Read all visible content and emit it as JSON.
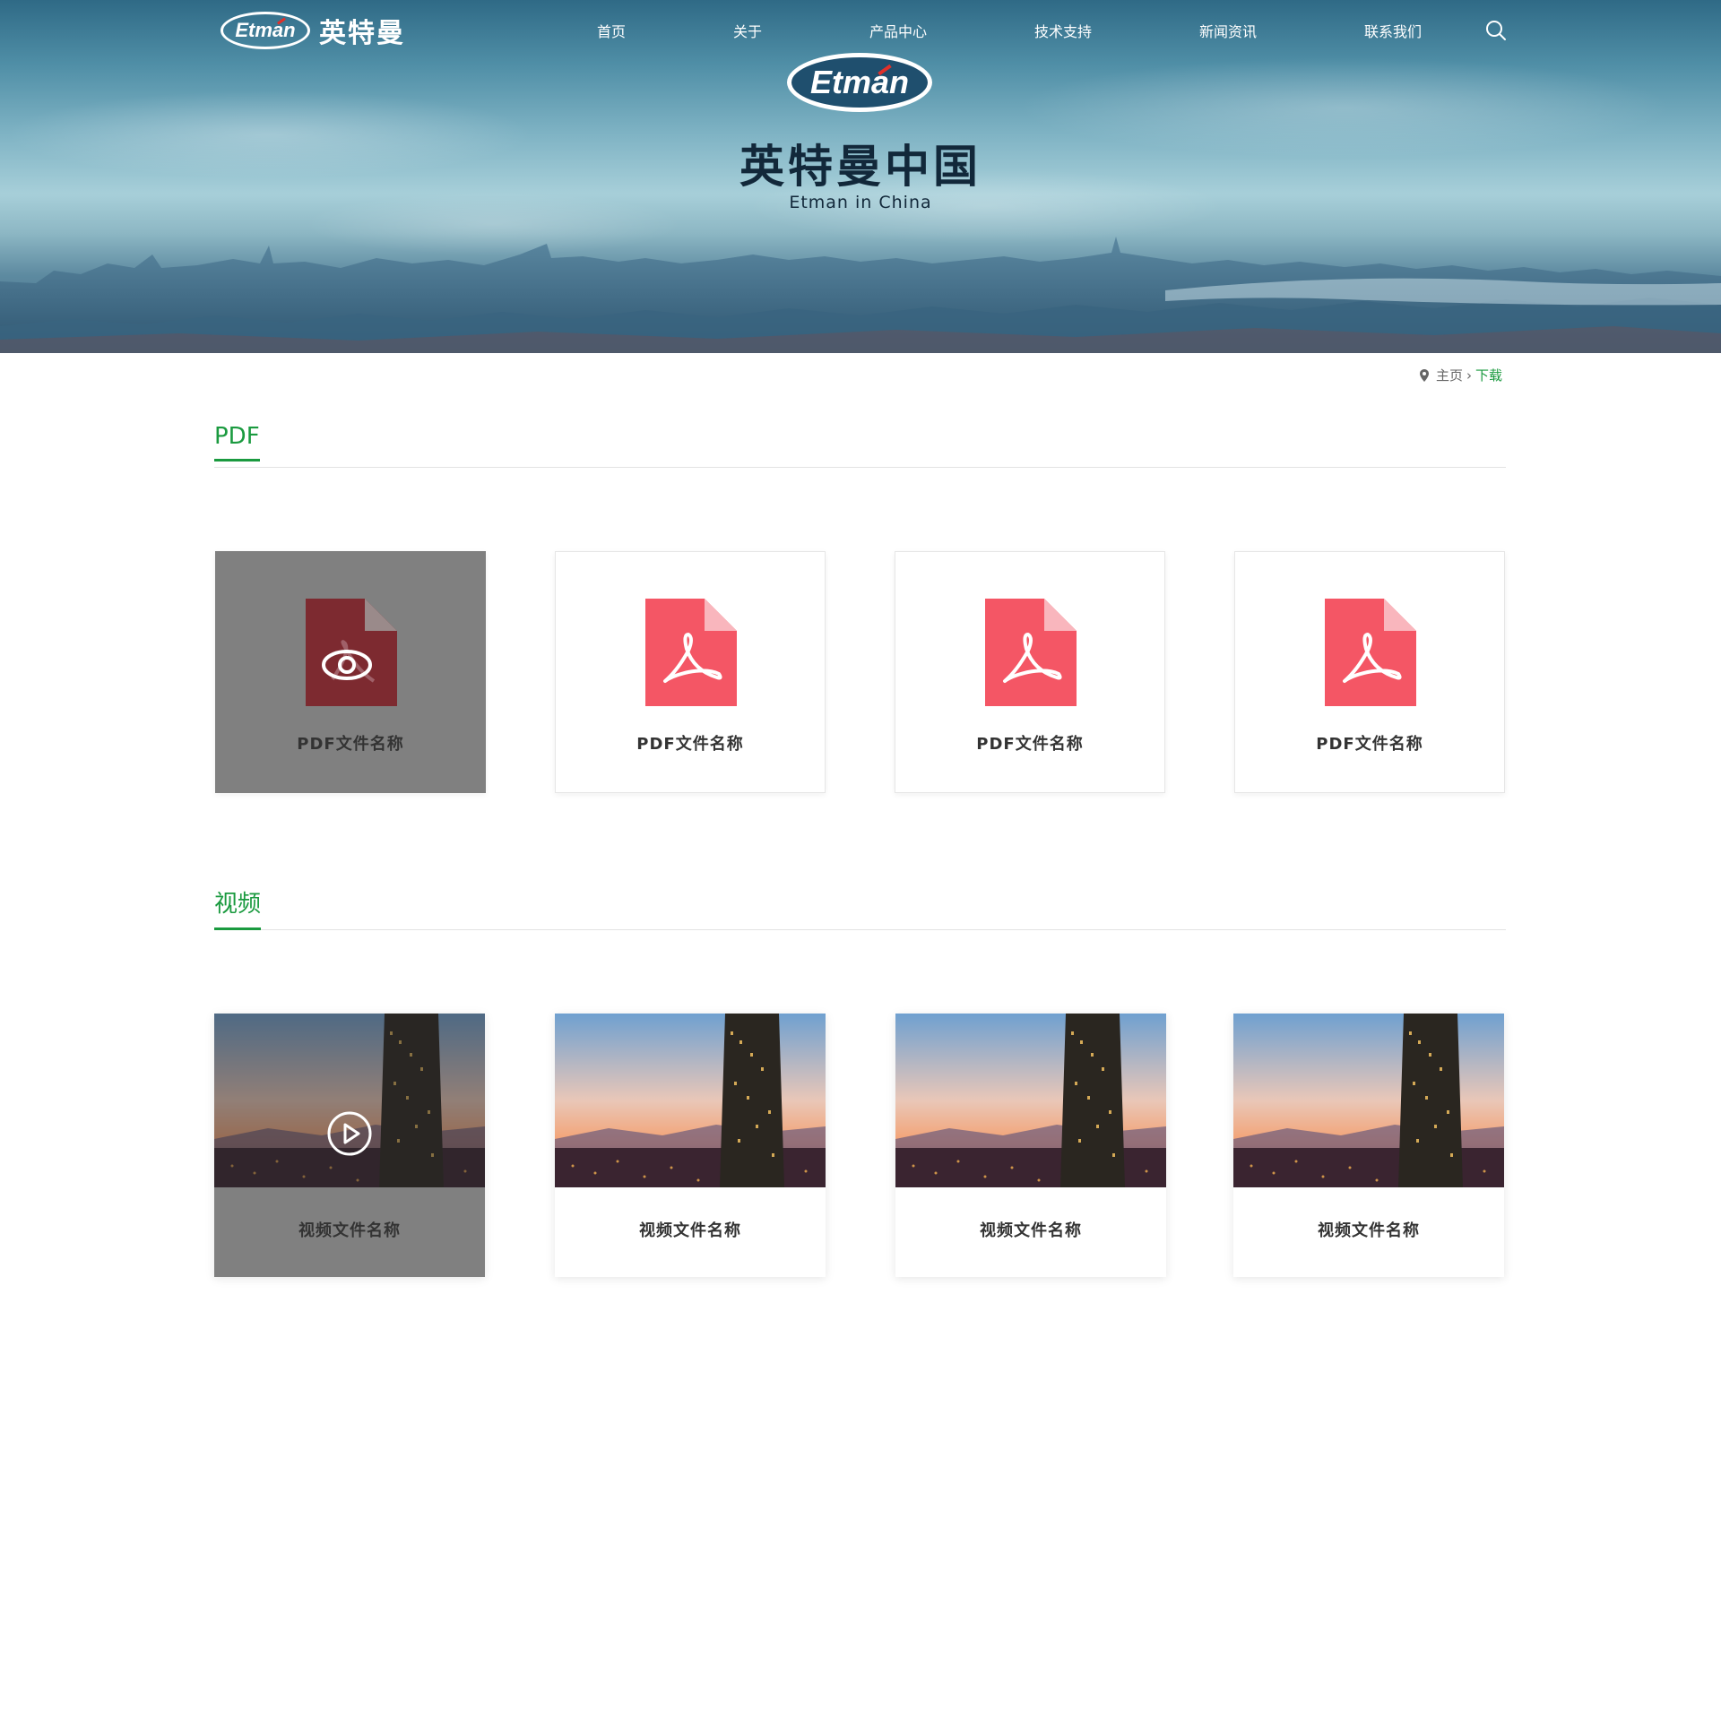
{
  "header": {
    "logo_text": "Etman",
    "brand_cn": "英特曼",
    "nav": [
      "首页",
      "关于",
      "产品中心",
      "技术支持",
      "新闻资讯",
      "联系我们"
    ],
    "search_icon": "search-icon"
  },
  "hero": {
    "logo_text": "Etman",
    "title": "英特曼中国",
    "subtitle": "Etman in China"
  },
  "breadcrumb": {
    "icon": "location-pin-icon",
    "home": "主页",
    "separator": "›",
    "current": "下载"
  },
  "pdf_section": {
    "title": "PDF",
    "items": [
      {
        "label": "PDF文件名称",
        "state": "hover"
      },
      {
        "label": "PDF文件名称"
      },
      {
        "label": "PDF文件名称"
      },
      {
        "label": "PDF文件名称"
      }
    ]
  },
  "video_section": {
    "title": "视频",
    "items": [
      {
        "label": "视频文件名称",
        "state": "hover"
      },
      {
        "label": "视频文件名称"
      },
      {
        "label": "视频文件名称"
      },
      {
        "label": "视频文件名称"
      }
    ]
  },
  "colors": {
    "accent_green": "#1a9a3f",
    "pdf_red": "#f45665",
    "pdf_red_dark": "#7d2a30",
    "hover_gray": "#808080"
  }
}
